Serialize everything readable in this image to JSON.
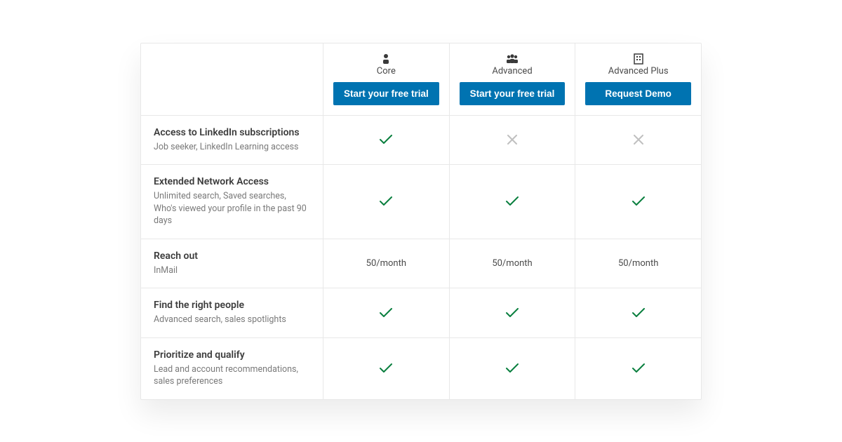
{
  "plans": [
    {
      "name": "Core",
      "cta": "Start your free trial",
      "icon": "person"
    },
    {
      "name": "Advanced",
      "cta": "Start your free trial",
      "icon": "people"
    },
    {
      "name": "Advanced Plus",
      "cta": "Request Demo",
      "icon": "building"
    }
  ],
  "features": [
    {
      "title": "Access to LinkedIn subscriptions",
      "desc": "Job seeker, LinkedIn Learning access",
      "values": [
        "check",
        "cross",
        "cross"
      ]
    },
    {
      "title": "Extended Network Access",
      "desc": "Unlimited search, Saved searches, Who's viewed your profile in the past 90 days",
      "values": [
        "check",
        "check",
        "check"
      ]
    },
    {
      "title": "Reach out",
      "desc": "InMail",
      "values": [
        "50/month",
        "50/month",
        "50/month"
      ]
    },
    {
      "title": "Find the right people",
      "desc": "Advanced search, sales spotlights",
      "values": [
        "check",
        "check",
        "check"
      ]
    },
    {
      "title": "Prioritize and qualify",
      "desc": "Lead and account recommendations, sales preferences",
      "values": [
        "check",
        "check",
        "check"
      ]
    }
  ]
}
